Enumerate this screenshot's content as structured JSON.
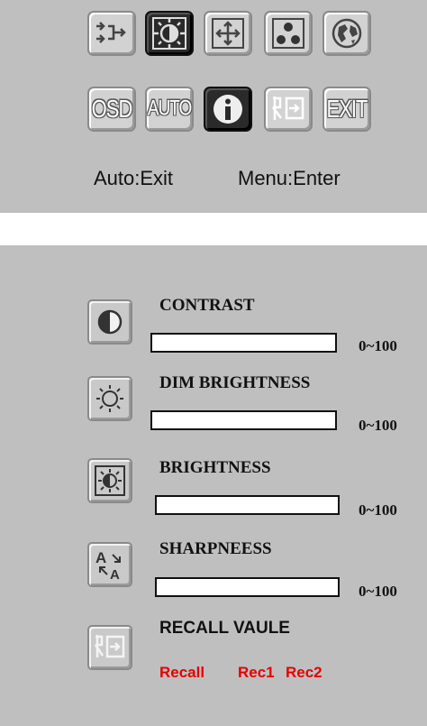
{
  "main_menu": {
    "row1": [
      {
        "icon": "input-select-icon",
        "selected": false
      },
      {
        "icon": "brightness-icon",
        "selected": true
      },
      {
        "icon": "position-icon",
        "selected": false
      },
      {
        "icon": "color-icon",
        "selected": false
      },
      {
        "icon": "globe-icon",
        "selected": false
      }
    ],
    "row2": [
      {
        "icon": "osd-icon",
        "label": "OSD",
        "selected": false
      },
      {
        "icon": "auto-icon",
        "label": "AUTO",
        "selected": false
      },
      {
        "icon": "info-icon",
        "selected": true
      },
      {
        "icon": "recall-icon",
        "selected": false
      },
      {
        "icon": "exit-icon",
        "label": "EXIT",
        "selected": false
      }
    ],
    "hint_auto": "Auto:Exit",
    "hint_menu": "Menu:Enter"
  },
  "submenu": {
    "contrast": {
      "label": "CONTRAST",
      "range": "0~100",
      "icon": "contrast-icon",
      "level": 0
    },
    "dim_brightness": {
      "label": "DIM  BRIGHTNESS",
      "range": "0~100",
      "icon": "sun-icon",
      "level": 0
    },
    "brightness": {
      "label": "BRIGHTNESS",
      "range": "0~100",
      "icon": "brightness-icon",
      "level": 0
    },
    "sharpness": {
      "label": "SHARPNEESS",
      "range": "0~100",
      "icon": "sharpness-icon",
      "level": 0
    },
    "recall": {
      "label": "RECALL VAULE",
      "icon": "recall-icon",
      "options": [
        "Recall",
        "Rec1",
        "Rec2"
      ]
    }
  },
  "colors": {
    "panel": "#bfbfbf",
    "selected_icon": "#2a2a2a",
    "recall_options": "#e60000"
  }
}
